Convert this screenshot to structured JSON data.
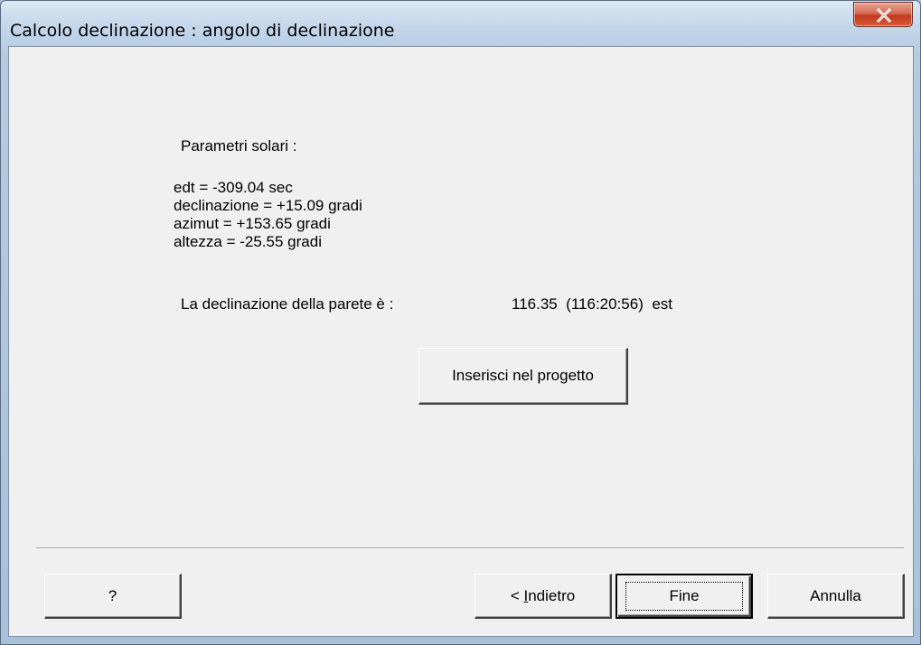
{
  "window": {
    "title": "Calcolo declinazione : angolo di declinazione",
    "close_icon": "close-icon"
  },
  "content": {
    "section_label": "Parametri solari :",
    "params": [
      "edt = -309.04 sec",
      "declinazione = +15.09 gradi",
      "azimut = +153.65 gradi",
      "altezza = -25.55 gradi"
    ],
    "result_label": "La declinazione della parete è :",
    "result_value": "116.35  (116:20:56)  est",
    "insert_button": "Inserisci nel progetto"
  },
  "footer": {
    "help_button": "?",
    "back_button_prefix": "< ",
    "back_button_accel": "I",
    "back_button_rest": "ndietro",
    "finish_button": "Fine",
    "cancel_button": "Annulla"
  }
}
